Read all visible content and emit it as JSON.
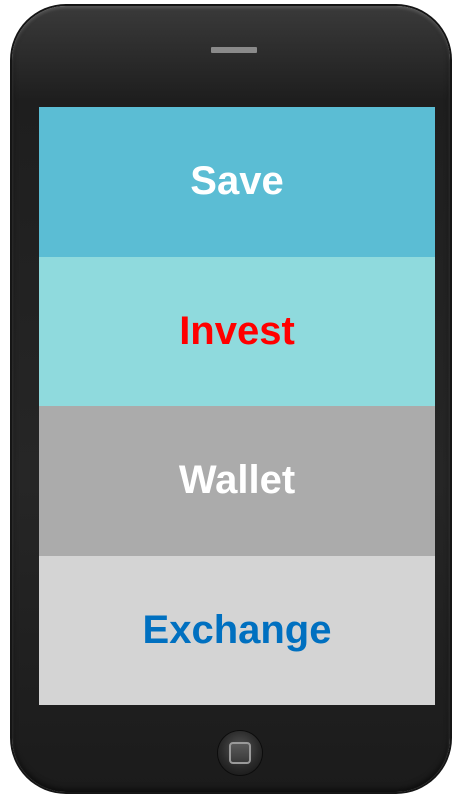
{
  "menu": {
    "items": [
      {
        "label": "Save",
        "background": "#5BBDD4",
        "text_color": "#FFFFFF"
      },
      {
        "label": "Invest",
        "background": "#8FDADD",
        "text_color": "#FF0000"
      },
      {
        "label": "Wallet",
        "background": "#ABABAB",
        "text_color": "#FFFFFF"
      },
      {
        "label": "Exchange",
        "background": "#D4D4D4",
        "text_color": "#0070C0"
      }
    ]
  },
  "device": {
    "body_color": "#262626",
    "speaker_icon": "speaker-icon",
    "home_button_icon": "home-button-icon"
  }
}
